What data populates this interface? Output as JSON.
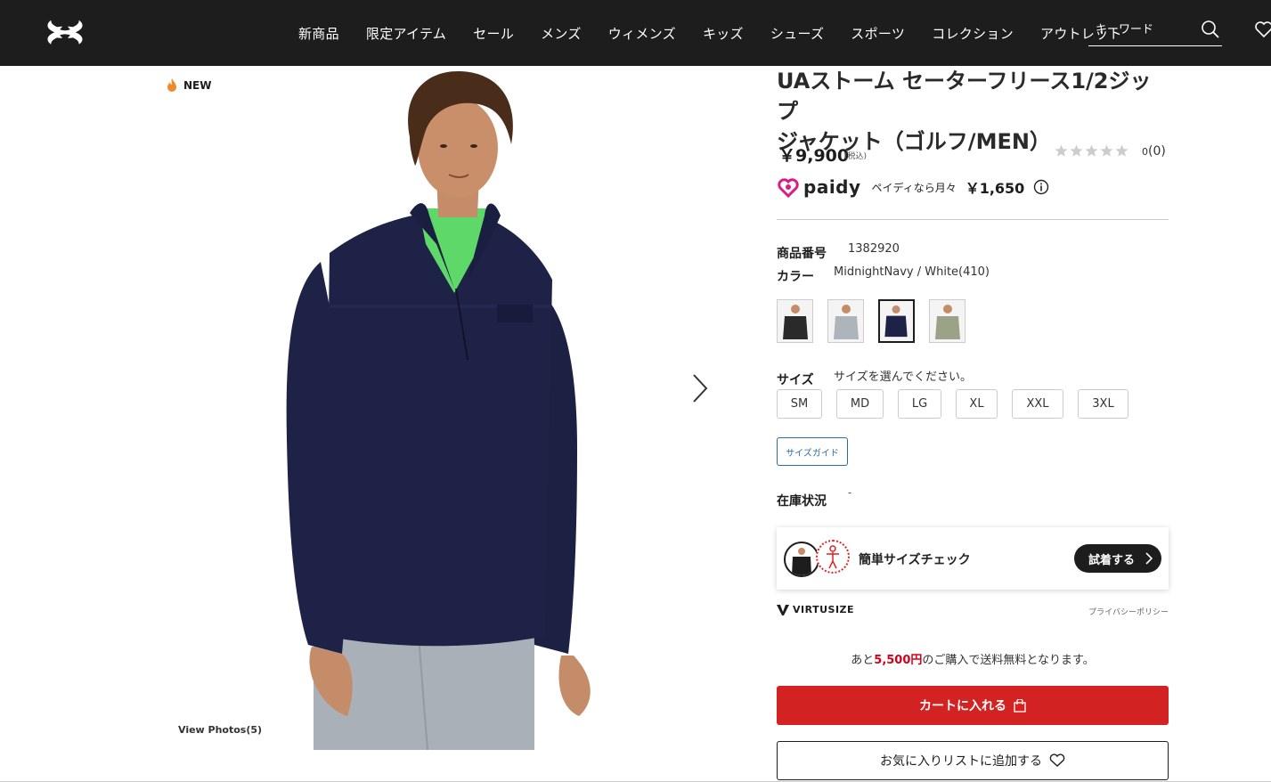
{
  "header": {
    "nav": [
      "新商品",
      "限定アイテム",
      "セール",
      "メンズ",
      "ウィメンズ",
      "キッズ",
      "シューズ",
      "スポーツ",
      "コレクション",
      "アウトレット"
    ],
    "search_placeholder": "キーワード"
  },
  "gallery": {
    "new_badge": "NEW",
    "view_photos": "View Photos(5)"
  },
  "product": {
    "title_line1": "UAストーム セーターフリース1/2ジップ",
    "title_line2": "ジャケット（ゴルフ/MEN）",
    "price": "￥9,900",
    "tax": "(税込)",
    "rating_count": "0",
    "rating_reviews": "(0)",
    "paidy_brand": "paidy",
    "paidy_text": "ペイディなら月々",
    "paidy_price": "￥1,650",
    "item_number_label": "商品番号",
    "item_number": "1382920",
    "color_label": "カラー",
    "color_value": "MidnightNavy / White(410)",
    "size_label": "サイズ",
    "size_hint": "サイズを選んでください。",
    "sizes": [
      "SM",
      "MD",
      "LG",
      "XL",
      "XXL",
      "3XL"
    ],
    "size_guide": "サイズガイド",
    "stock_label": "在庫状況",
    "stock_value": "-",
    "vs_text": "簡単サイズチェック",
    "vs_button": "試着する",
    "virtusize": "VIRTUSIZE",
    "privacy": "プライバシーポリシー",
    "ship_prefix": "あと",
    "ship_amount": "5,500円",
    "ship_suffix": "のご購入で送料無料となります。",
    "cart_button": "カートに入れる",
    "fav_button": "お気に入りリストに追加する"
  },
  "colors": {
    "header_bg": "#1d1d1d",
    "accent_red": "#d32222",
    "link_blue": "#2d6aa8",
    "navy": "#1e2247"
  },
  "icons": [
    "ua-logo-icon",
    "search-icon",
    "heart-icon",
    "flame-icon",
    "chevron-right-icon",
    "star-icon",
    "paidy-logo-icon",
    "info-icon",
    "bag-icon"
  ]
}
